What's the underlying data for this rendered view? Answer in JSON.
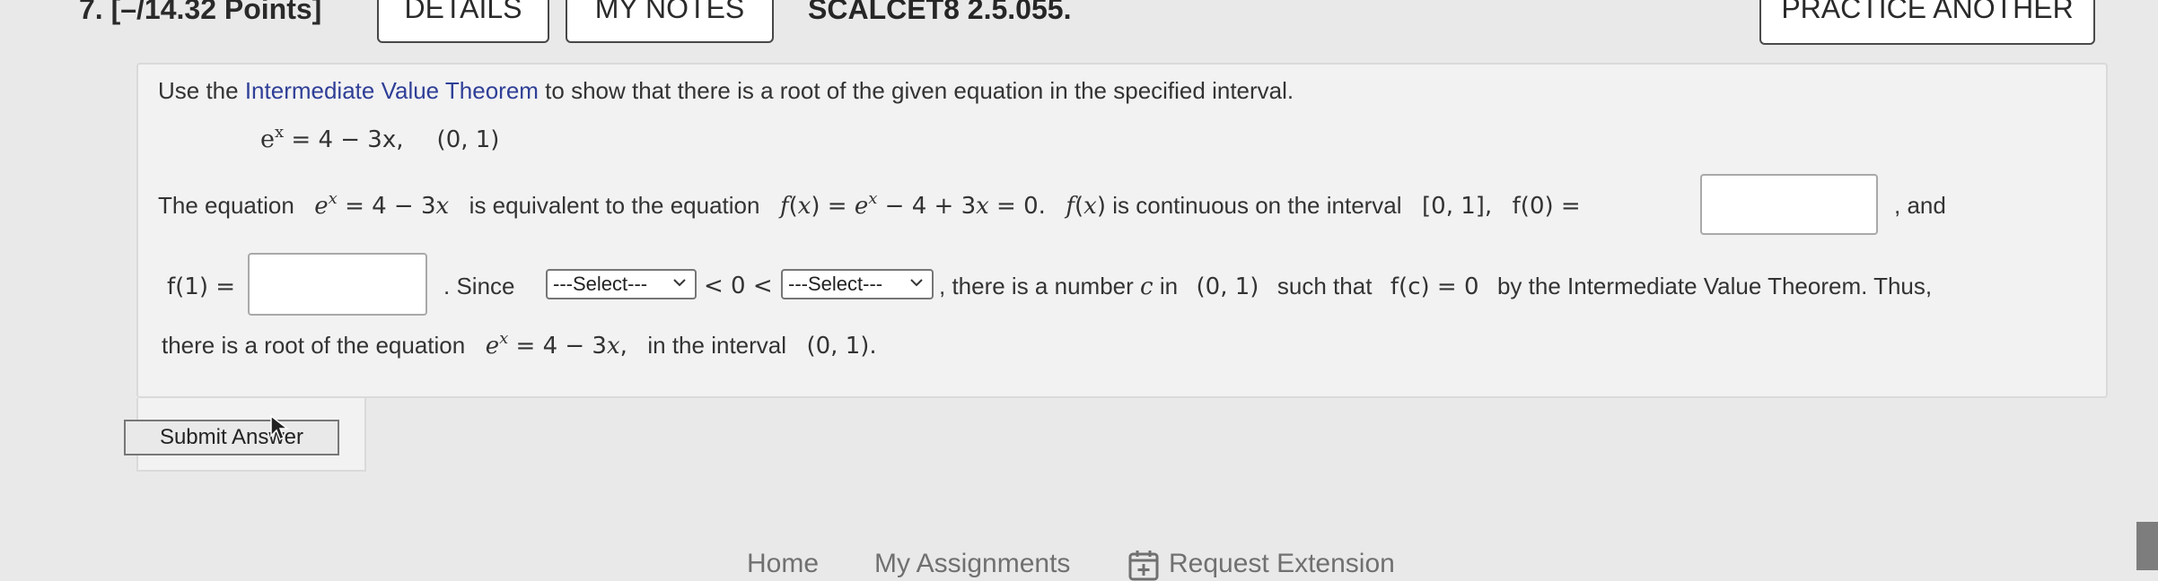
{
  "header": {
    "question_number": "7.",
    "points": "[–/14.32 Points]",
    "details_label": "DETAILS",
    "my_notes_label": "MY NOTES",
    "question_id": "SCALCET8 2.5.055.",
    "practice_another_label": "PRACTICE ANOTHER"
  },
  "question": {
    "intro_before": "Use the ",
    "intro_link": "Intermediate Value Theorem",
    "intro_after": " to show that there is a root of the given equation in the specified interval.",
    "eq_base": "e",
    "eq_exp": "x",
    "eq_rhs": " = 4 − 3x,",
    "eq_interval": "(0, 1)",
    "l1_text1": "The equation",
    "l1_text2": "is equivalent to the equation",
    "l1_text3": "is continuous on the interval",
    "l1_interval": "[0, 1],",
    "l1_f0_label": "f(0) =",
    "l1_and": ", and",
    "f1_label": "f(1) =",
    "since_text": ". Since",
    "lt_zero_lt": "< 0 <",
    "l2_text1": ", there is a number",
    "l2_c": "c",
    "l2_in": "in",
    "l2_interval": "(0, 1)",
    "l2_text2": "such that",
    "l2_fc": "f(c) = 0",
    "l2_text3": "by the Intermediate Value Theorem. Thus,",
    "l3_text1": "there is a root of the equation",
    "l3_text2": "in the interval",
    "l3_interval": "(0, 1).",
    "select1_value": "---Select---",
    "select2_value": "---Select---",
    "f0_value": "",
    "f1_value": ""
  },
  "submit_label": "Submit Answer",
  "footer": {
    "home": "Home",
    "my_assignments": "My Assignments",
    "request_extension": "Request Extension"
  },
  "colors": {
    "link": "#2f3f97",
    "panel_bg": "#f2f2f3",
    "page_bg": "#e9e9ea"
  }
}
